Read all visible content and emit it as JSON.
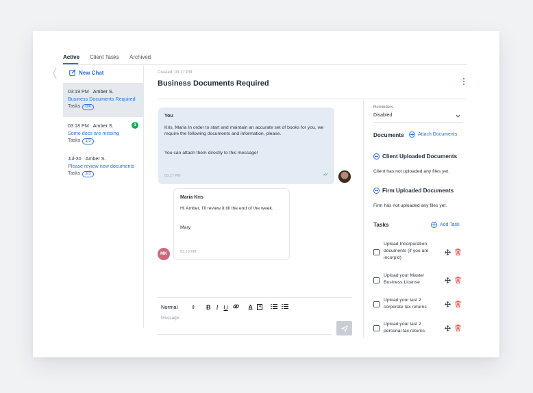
{
  "tabs": [
    "Active",
    "Client Tasks",
    "Archived"
  ],
  "new_chat_label": "New Chat",
  "conversations": [
    {
      "time": "03:19 PM",
      "name": "Amber S.",
      "subject": "Business Documents Required",
      "tasks_label": "Tasks",
      "tasks_count": "0/4"
    },
    {
      "time": "03:18 PM",
      "name": "Amber S.",
      "subject": "Some docs are missing",
      "tasks_label": "Tasks",
      "tasks_count": "1/3",
      "unread": "1"
    },
    {
      "time": "Jul-30",
      "name": "Amber S.",
      "subject": "Please review new documents",
      "tasks_label": "Tasks",
      "tasks_count": "3/3"
    }
  ],
  "thread": {
    "created": "Created: 03:17 PM",
    "title": "Business Documents Required"
  },
  "messages": [
    {
      "author": "You",
      "paragraphs": [
        "Kris, Maria In order to start and maintain an accurate set of books for you, we require the following documents and information, please.",
        "You can attach them directly to this message!"
      ],
      "time": "03:17 PM"
    },
    {
      "author": "Maria Kris",
      "paragraphs": [
        "Hi Amber, I'll review it till the end of the week.",
        "Mary"
      ],
      "time": "03:19 PM",
      "initials": "MK"
    }
  ],
  "composer": {
    "format": "Normal",
    "placeholder": "Message"
  },
  "panel": {
    "reminders_label": "Reminders",
    "reminders_value": "Disabled",
    "documents_heading": "Documents",
    "attach_documents": "Attach Documents",
    "client_uploaded_heading": "Client Uploaded Documents",
    "client_uploaded_empty": "Client has not uploaded any files yet.",
    "firm_uploaded_heading": "Firm Uploaded Documents",
    "firm_uploaded_empty": "Firm has not uploaded any files yet.",
    "tasks_heading": "Tasks",
    "add_task": "Add Task",
    "tasks": [
      "Upload Incorporation documents (if you are incorp'd)",
      "Upload your Master Business License",
      "Upload your last 2 corporate tax returns",
      "Upload your last 2 personal tax returns"
    ]
  },
  "colors": {
    "accent": "#2d6fd6",
    "success": "#22a559",
    "danger": "#e0413a",
    "selected_row": "#e5e9ee",
    "bubble_you": "#e4ebf5"
  }
}
